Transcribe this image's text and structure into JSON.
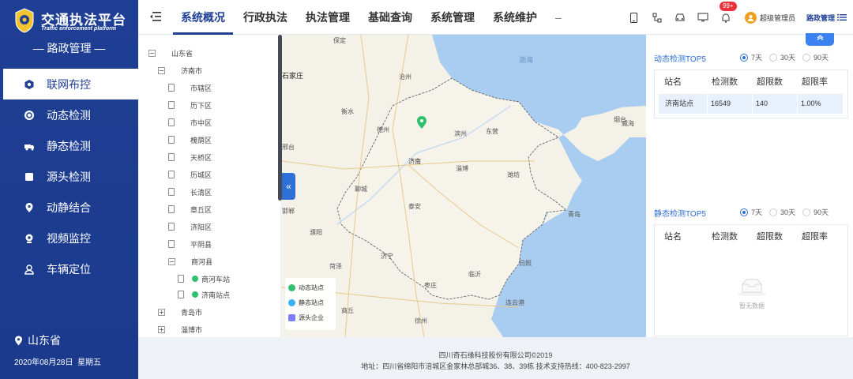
{
  "brand": {
    "title": "交通执法平台",
    "subtitle": "Traffic enforcement platform",
    "section": "— 路政管理 —"
  },
  "sidebar": {
    "items": [
      {
        "label": "联网布控",
        "icon": "hexagon-icon",
        "active": true
      },
      {
        "label": "动态检测",
        "icon": "gauge-icon",
        "active": false
      },
      {
        "label": "静态检测",
        "icon": "truck-icon",
        "active": false
      },
      {
        "label": "源头检测",
        "icon": "square-icon",
        "active": false
      },
      {
        "label": "动静结合",
        "icon": "location-pin-icon",
        "active": false
      },
      {
        "label": "视频监控",
        "icon": "camera-icon",
        "active": false
      },
      {
        "label": "车辆定位",
        "icon": "person-pin-icon",
        "active": false
      }
    ],
    "location": "山东省",
    "date": "2020年08月28日",
    "weekday": "星期五"
  },
  "nav": {
    "tabs": [
      "系统概况",
      "行政执法",
      "执法管理",
      "基础查询",
      "系统管理",
      "系统维护"
    ],
    "more": "–",
    "badge": "99+",
    "user": "超级管理员",
    "route": "路政管理"
  },
  "tree": {
    "root": "山东省",
    "city": "济南市",
    "districts": [
      "市辖区",
      "历下区",
      "市中区",
      "槐荫区",
      "天桥区",
      "历城区",
      "长清区",
      "章丘区",
      "济阳区",
      "平阴县"
    ],
    "county": "商河县",
    "stations": [
      "商河车站",
      "济南站点"
    ],
    "others": [
      "青岛市",
      "淄博市"
    ]
  },
  "map": {
    "labels": [
      "保定",
      "沧州",
      "石家庄",
      "衡水",
      "德州",
      "邢台",
      "聊城",
      "济南",
      "淄博",
      "潍坊",
      "东营",
      "滨州",
      "烟台",
      "泰安",
      "青岛",
      "临沂",
      "济宁",
      "菏泽",
      "枣庄",
      "日照",
      "连云港",
      "徐州",
      "商丘",
      "濮阳",
      "邯郸",
      "威海",
      "渤海"
    ],
    "legend": [
      "动态站点",
      "静态站点",
      "源头企业"
    ],
    "legend_colors": [
      "#2fc26d",
      "#3ab0ff",
      "#7d7cff"
    ]
  },
  "dynamic": {
    "title": "动态检测TOP5",
    "options": [
      "7天",
      "30天",
      "90天"
    ],
    "selected": "7天",
    "columns": [
      "站名",
      "检测数",
      "超限数",
      "超限率"
    ],
    "rows": [
      {
        "name": "济南站点",
        "count": "16549",
        "over": "140",
        "rate": "1.00%"
      }
    ]
  },
  "static": {
    "title": "静态检测TOP5",
    "options": [
      "7天",
      "30天",
      "90天"
    ],
    "selected": "7天",
    "columns": [
      "站名",
      "检测数",
      "超限数",
      "超限率"
    ],
    "empty": "暂无数据"
  },
  "footer": {
    "company": "四川奇石缘科技股份有限公司©2019",
    "address": "地址：四川省绵阳市涪城区金家林总部城36、38、39栋    技术支持热线：400-823-2997"
  },
  "colors": {
    "primary": "#1f3f95",
    "accent": "#2d6fd6",
    "badge": "#e8313a",
    "station": "#2fc26d"
  }
}
